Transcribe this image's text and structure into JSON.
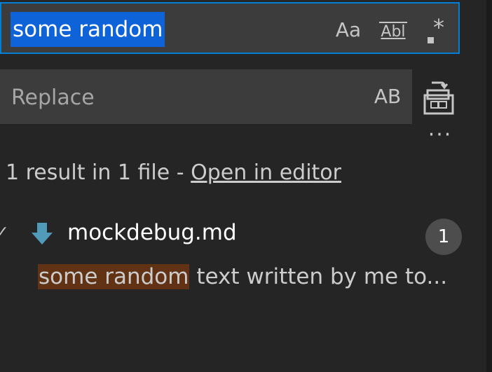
{
  "search": {
    "query": "some random",
    "match_case_label": "Aa",
    "whole_word_label": "Abl",
    "regex_label": "*"
  },
  "replace": {
    "placeholder": "Replace",
    "preserve_case_label": "AB",
    "more_label": "···"
  },
  "summary": {
    "text": "1 result in 1 file - ",
    "link": "Open in editor"
  },
  "results": {
    "file": {
      "twistie": "✓",
      "name": "mockdebug.md",
      "count": "1"
    },
    "match": {
      "highlight": "some random",
      "rest": " text written by me to..."
    }
  },
  "colors": {
    "focus_border": "#007fd4",
    "selection": "#0e63d8",
    "match_highlight": "#613214",
    "file_icon": "#519aba"
  }
}
